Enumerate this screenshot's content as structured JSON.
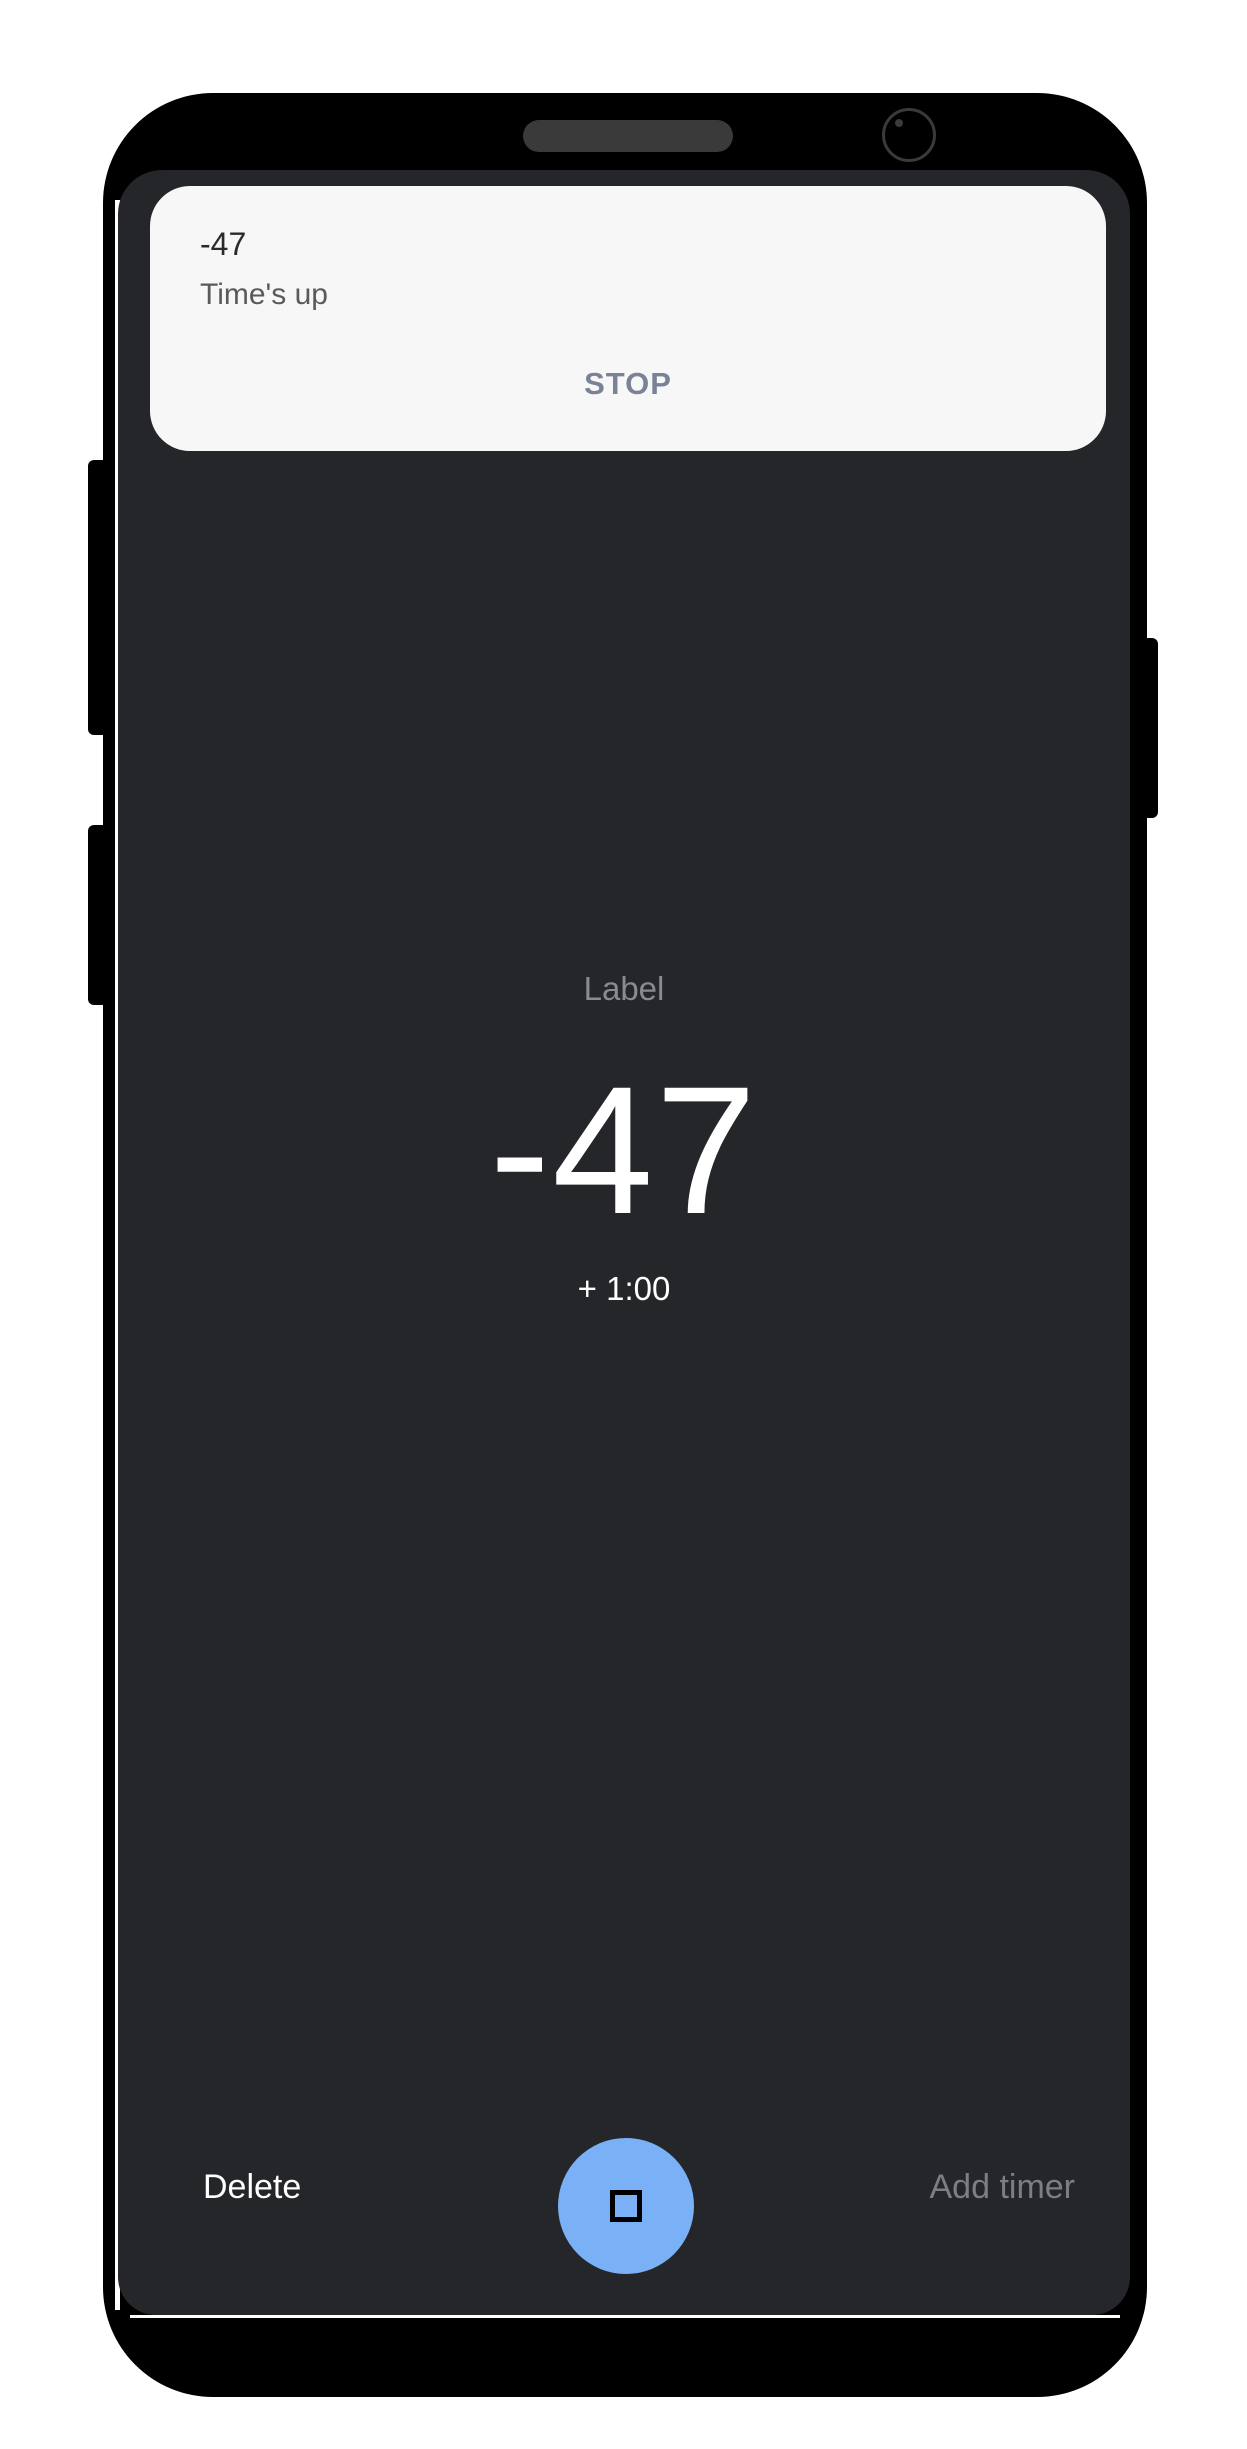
{
  "notification": {
    "title": "-47",
    "text": "Time's up",
    "action": "STOP"
  },
  "timer": {
    "label": "Label",
    "value": "-47",
    "add_time": "+ 1:00"
  },
  "actions": {
    "delete": "Delete",
    "add_timer": "Add timer",
    "fab_icon": "stop-icon"
  },
  "colors": {
    "background": "#252629",
    "accent": "#7ab0f5",
    "notification_bg": "#f7f7f7"
  }
}
